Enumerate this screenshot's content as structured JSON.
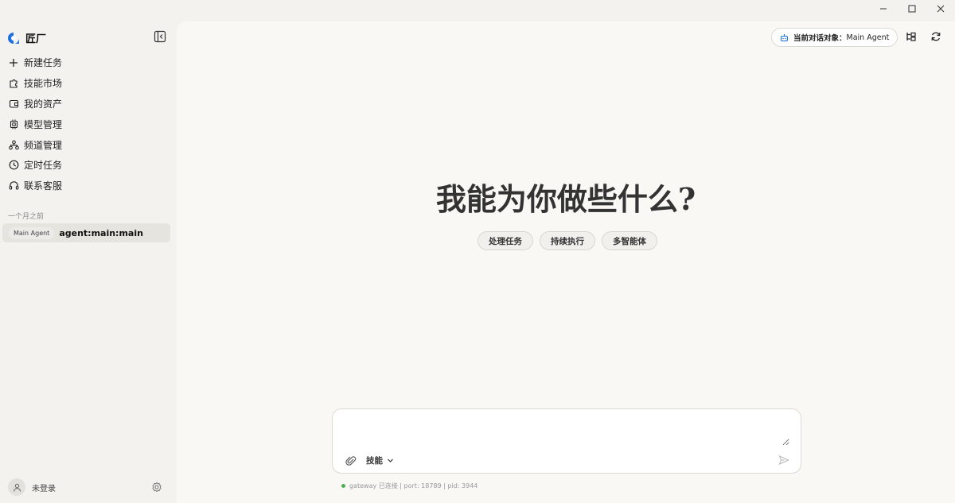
{
  "app": {
    "name": "匠厂"
  },
  "sidebar": {
    "items": [
      {
        "label": "新建任务",
        "icon": "plus-icon"
      },
      {
        "label": "技能市场",
        "icon": "puzzle-icon"
      },
      {
        "label": "我的资产",
        "icon": "wallet-icon"
      },
      {
        "label": "模型管理",
        "icon": "chip-icon"
      },
      {
        "label": "频道管理",
        "icon": "network-icon"
      },
      {
        "label": "定时任务",
        "icon": "clock-icon"
      },
      {
        "label": "联系客服",
        "icon": "headset-icon"
      }
    ],
    "section_label": "一个月之前",
    "sessions": [
      {
        "badge": "Main Agent",
        "title": "agent:main:main"
      }
    ],
    "user_label": "未登录"
  },
  "header": {
    "target_label": "当前对话对象：",
    "target_value": "Main Agent"
  },
  "main": {
    "headline": "我能为你做些什么?",
    "chips": [
      "处理任务",
      "持续执行",
      "多智能体"
    ]
  },
  "composer": {
    "placeholder": "",
    "skill_label": "技能"
  },
  "status": {
    "text": "gateway 已连接 | port: 18789 | pid: 3944",
    "color": "#4caf50"
  },
  "colors": {
    "accent": "#1e6fe0",
    "background": "#f3f2ee",
    "main": "#f9f8f5"
  }
}
